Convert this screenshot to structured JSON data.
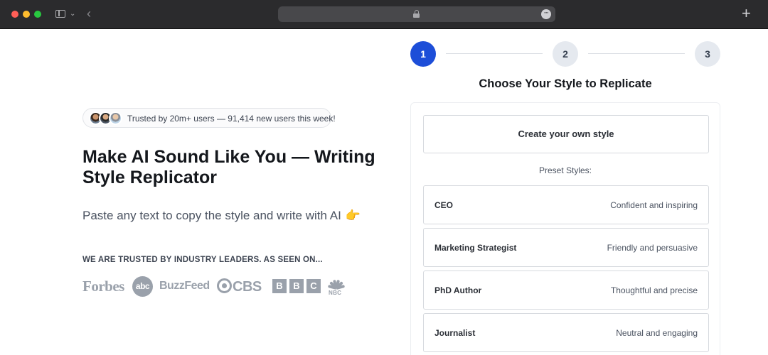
{
  "browser": {
    "address_text": ""
  },
  "hero": {
    "trust_text": "Trusted by 20m+ users — 91,414 new users this week!",
    "title": "Make AI Sound Like You — Writing Style Replicator",
    "subtitle": "Paste any text to copy the style and write with AI",
    "subtitle_emoji": "👉",
    "leaders_label": "WE ARE TRUSTED BY INDUSTRY LEADERS. AS SEEN ON...",
    "logos": [
      "Forbes",
      "abc",
      "BuzzFeed",
      "CBS",
      "BBC",
      "NBC"
    ]
  },
  "stepper": {
    "steps": [
      {
        "label": "1",
        "state": "active"
      },
      {
        "label": "2",
        "state": "inactive"
      },
      {
        "label": "3",
        "state": "inactive"
      }
    ],
    "active_color": "#1d4ed8"
  },
  "panel": {
    "title": "Choose Your Style to Replicate",
    "create_label": "Create your own style",
    "preset_label": "Preset Styles:",
    "styles": [
      {
        "name": "CEO",
        "description": "Confident and inspiring"
      },
      {
        "name": "Marketing Strategist",
        "description": "Friendly and persuasive"
      },
      {
        "name": "PhD Author",
        "description": "Thoughtful and precise"
      },
      {
        "name": "Journalist",
        "description": "Neutral and engaging"
      }
    ]
  }
}
